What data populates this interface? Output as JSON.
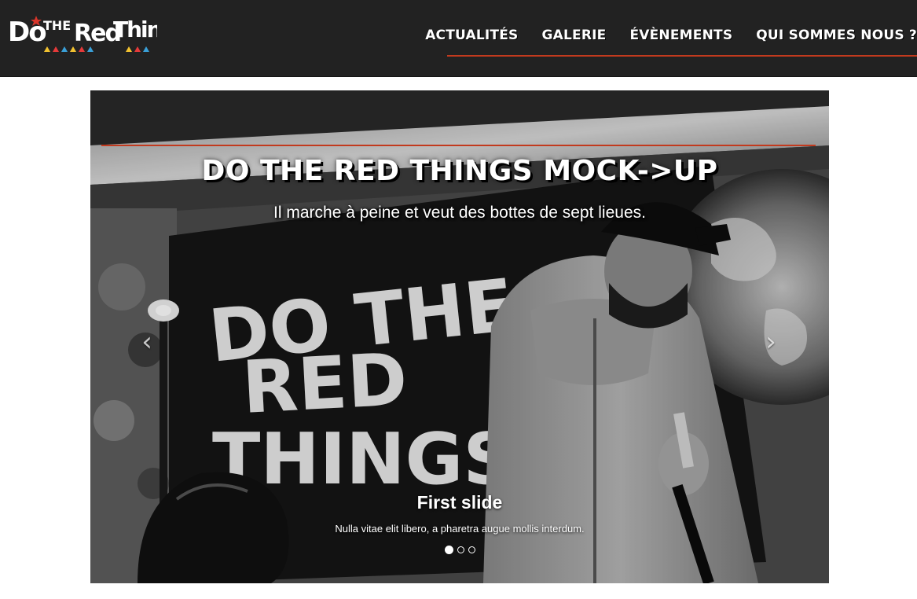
{
  "brand": {
    "logo_text": "DoTHERedThing",
    "accent_color": "#c23a1e"
  },
  "nav": {
    "items": [
      {
        "label": "ACTUALITÉS"
      },
      {
        "label": "GALERIE"
      },
      {
        "label": "ÉVÈNEMENTS"
      },
      {
        "label": "QUI SOMMES NOUS ?"
      }
    ]
  },
  "hero": {
    "title": "DO THE RED THINGS MOCK->UP",
    "subtitle": "Il marche à peine et veut des bottes de sept lieues.",
    "poster_text": [
      "DO THE",
      "RED",
      "THINGS"
    ]
  },
  "carousel": {
    "prev_icon": "chevron-left-icon",
    "next_icon": "chevron-right-icon",
    "prev_glyph": "‹",
    "next_glyph": "›",
    "slide": {
      "title": "First slide",
      "text": "Nulla vitae elit libero, a pharetra augue mollis interdum."
    },
    "slide_count": 3,
    "active_index": 0
  }
}
